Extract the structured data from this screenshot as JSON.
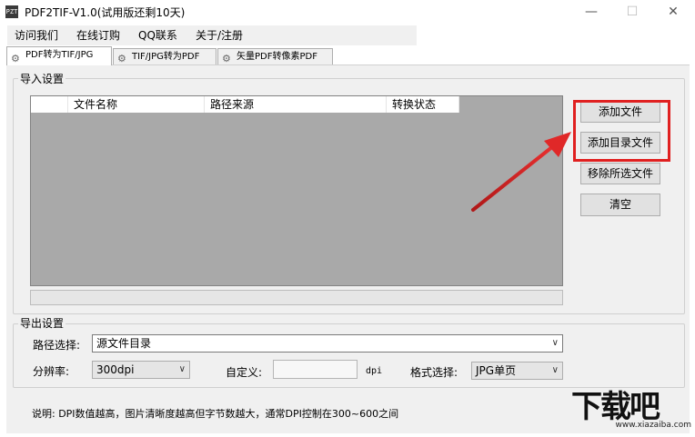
{
  "window": {
    "title": "PDF2TIF-V1.0(试用版还剩10天)",
    "icon_text": "PZT",
    "minimize": "—",
    "maximize": "☐",
    "close": "✕"
  },
  "menu": [
    "访问我们",
    "在线订购",
    "QQ联系",
    "关于/注册"
  ],
  "tabs": [
    {
      "label": "PDF转为TIF/JPG",
      "active": true
    },
    {
      "label": "TIF/JPG转为PDF",
      "active": false
    },
    {
      "label": "矢量PDF转像素PDF",
      "active": false
    }
  ],
  "import_section": {
    "title": "导入设置",
    "columns": [
      "文件名称",
      "路径来源",
      "转换状态"
    ],
    "buttons": {
      "add_file": "添加文件",
      "add_folder": "添加目录文件",
      "remove_selected": "移除所选文件",
      "clear": "清空"
    }
  },
  "export_section": {
    "title": "导出设置",
    "path_label": "路径选择:",
    "path_value": "源文件目录",
    "dpi_label": "分辨率:",
    "dpi_value": "300dpi",
    "custom_label": "自定义:",
    "custom_value": "",
    "dpi_unit": "dpi",
    "format_label": "格式选择:",
    "format_value": "JPG单页"
  },
  "note": "说明: DPI数值越高，图片清晰度越高但字节数越大，通常DPI控制在300~600之间",
  "watermark": {
    "main": "下载吧",
    "sub": "www.xiazaiba.com"
  },
  "colors": {
    "highlight": "#e02020",
    "arrow": "#d42020",
    "listview_bg": "#a9a9a9"
  }
}
